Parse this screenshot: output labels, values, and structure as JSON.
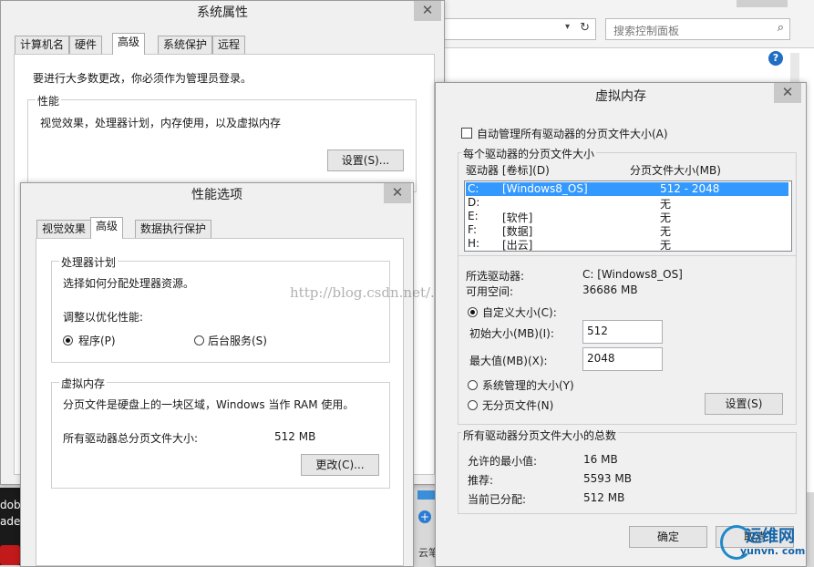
{
  "explorer": {
    "search_placeholder": "搜索控制面板",
    "help": "?"
  },
  "sys_props": {
    "title": "系统属性",
    "tabs": [
      "计算机名",
      "硬件",
      "高级",
      "系统保护",
      "远程"
    ],
    "admin_note": "要进行大多数更改，你必须作为管理员登录。",
    "perf_group": "性能",
    "perf_desc": "视觉效果，处理器计划，内存使用，以及虚拟内存",
    "settings_btn": "设置(S)..."
  },
  "perf_opts": {
    "title": "性能选项",
    "tabs": [
      "视觉效果",
      "高级",
      "数据执行保护"
    ],
    "cpu_group": "处理器计划",
    "cpu_desc": "选择如何分配处理器资源。",
    "optimize_label": "调整以优化性能:",
    "radio_programs": "程序(P)",
    "radio_background": "后台服务(S)",
    "vm_group": "虚拟内存",
    "vm_desc": "分页文件是硬盘上的一块区域，Windows 当作 RAM 使用。",
    "total_label": "所有驱动器总分页文件大小:",
    "total_value": "512 MB",
    "change_btn": "更改(C)..."
  },
  "watermark": "http://blog.csdn.net/..guo",
  "vmem": {
    "title": "虚拟内存",
    "auto_manage": "自动管理所有驱动器的分页文件大小(A)",
    "per_drive_group": "每个驱动器的分页文件大小",
    "col_drive": "驱动器 [卷标](D)",
    "col_size": "分页文件大小(MB)",
    "drives": [
      {
        "drive": "C:",
        "label": "[Windows8_OS]",
        "size": "512 - 2048"
      },
      {
        "drive": "D:",
        "label": "",
        "size": "无"
      },
      {
        "drive": "E:",
        "label": "[软件]",
        "size": "无"
      },
      {
        "drive": "F:",
        "label": "[数据]",
        "size": "无"
      },
      {
        "drive": "H:",
        "label": "[出云]",
        "size": "无"
      }
    ],
    "selected_label": "所选驱动器:",
    "selected_value": "C:  [Windows8_OS]",
    "free_label": "可用空间:",
    "free_value": "36686 MB",
    "custom_size": "自定义大小(C):",
    "initial_label": "初始大小(MB)(I):",
    "initial_value": "512",
    "max_label": "最大值(MB)(X):",
    "max_value": "2048",
    "system_managed": "系统管理的大小(Y)",
    "no_paging": "无分页文件(N)",
    "set_btn": "设置(S)",
    "total_group": "所有驱动器分页文件大小的总数",
    "min_label": "允许的最小值:",
    "min_value": "16 MB",
    "rec_label": "推荐:",
    "rec_value": "5593 MB",
    "alloc_label": "当前已分配:",
    "alloc_value": "512 MB",
    "ok_btn": "确定",
    "cancel_btn": "取消"
  },
  "logo": {
    "cn": "运维网",
    "url": "yunvn. com"
  },
  "bg_snippets": {
    "left1": "dob",
    "left2": "ader",
    "right": "云笔"
  }
}
